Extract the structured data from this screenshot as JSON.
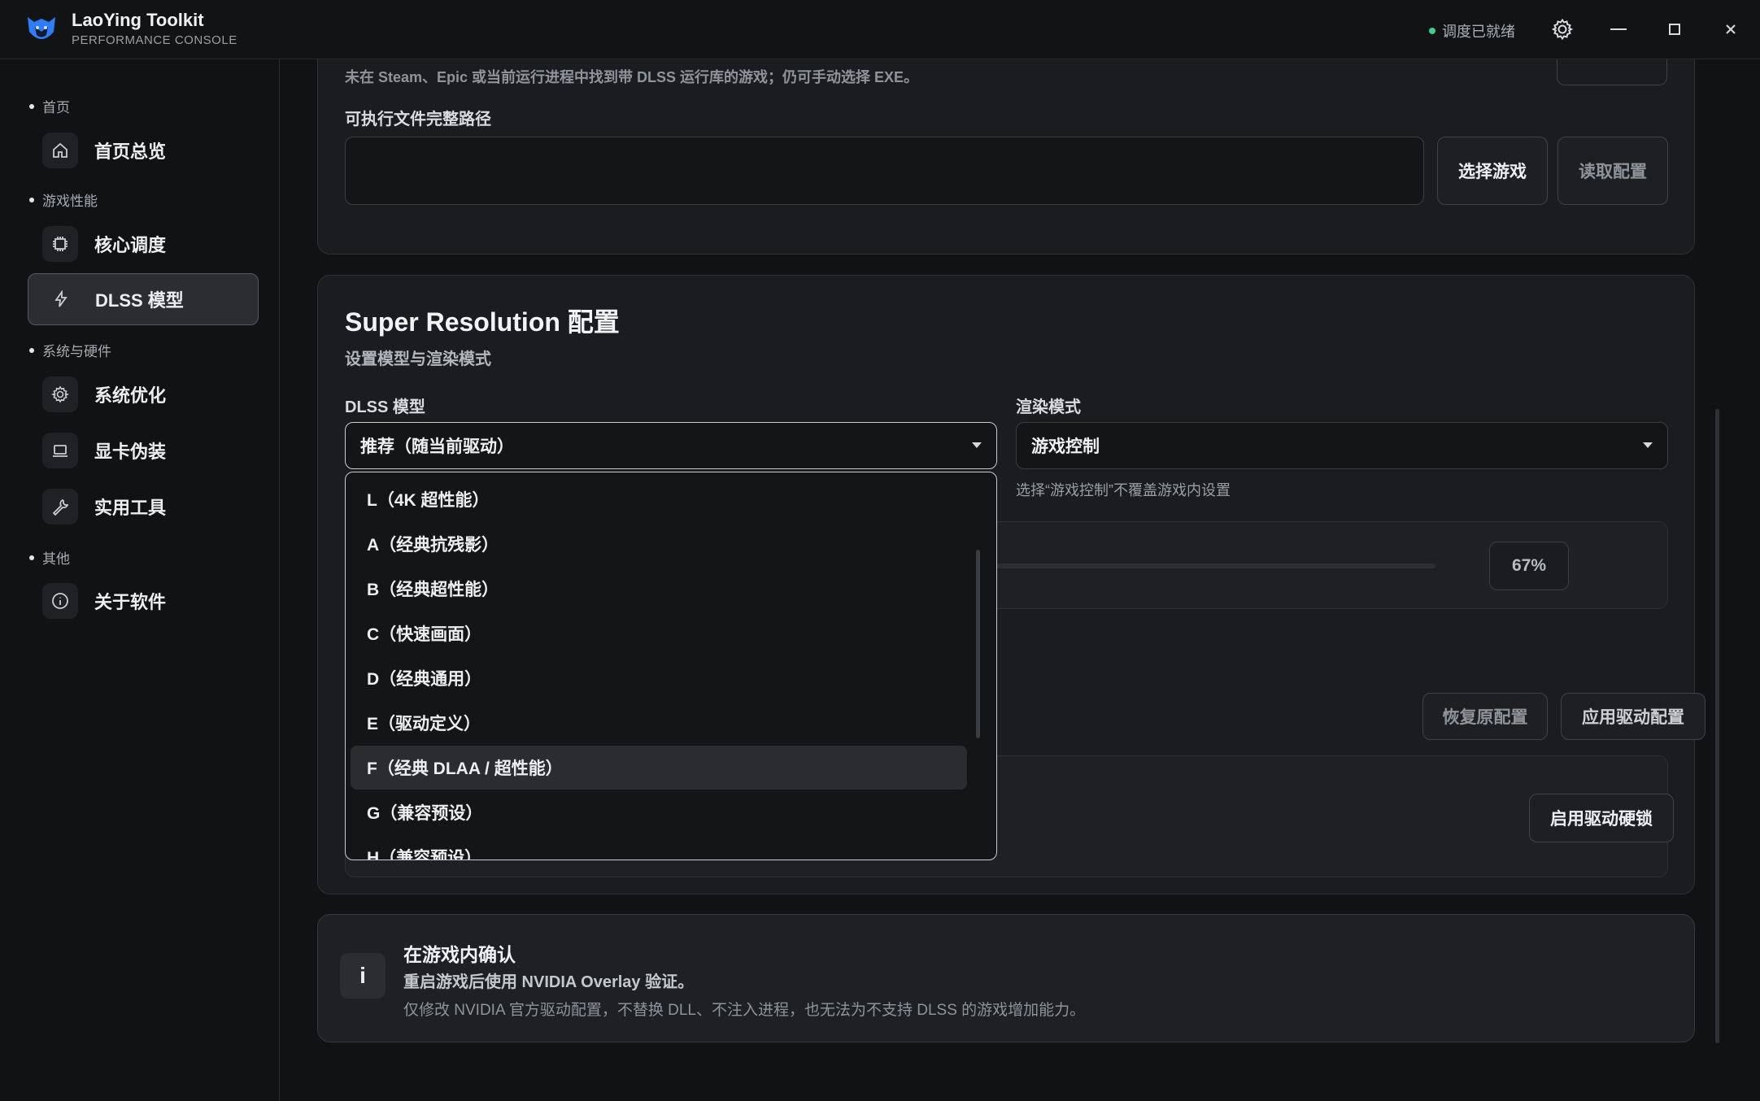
{
  "app": {
    "title": "LaoYing Toolkit",
    "subtitle": "PERFORMANCE CONSOLE",
    "status": "调度已就绪",
    "accent": "#3b8cff",
    "status_color": "#3ecf8e"
  },
  "window_controls": [
    "settings-icon",
    "minimize-icon",
    "maximize-icon",
    "close-icon"
  ],
  "sidebar": {
    "sections": [
      {
        "label": "首页",
        "items": [
          {
            "label": "首页总览",
            "icon": "home-icon"
          }
        ]
      },
      {
        "label": "游戏性能",
        "items": [
          {
            "label": "核心调度",
            "icon": "cpu-icon"
          },
          {
            "label": "DLSS 模型",
            "icon": "bolt-icon",
            "active": true
          }
        ]
      },
      {
        "label": "系统与硬件",
        "items": [
          {
            "label": "系统优化",
            "icon": "gear-icon"
          },
          {
            "label": "显卡伪装",
            "icon": "monitor-icon"
          },
          {
            "label": "实用工具",
            "icon": "wrench-icon"
          }
        ]
      },
      {
        "label": "其他",
        "items": [
          {
            "label": "关于软件",
            "icon": "info-icon"
          }
        ]
      }
    ]
  },
  "game_card": {
    "partial_hint": "未在 Steam、Epic 或当前运行进程中找到带 DLSS 运行库的游戏；仍可手动选择 EXE。",
    "path_label": "可执行文件完整路径",
    "path_value": "",
    "select_button": "选择游戏",
    "read_button": "读取配置"
  },
  "sr_card": {
    "title": "Super Resolution 配置",
    "subtitle": "设置模型与渲染模式",
    "model_label": "DLSS 模型",
    "model_value": "推荐（随当前驱动）",
    "model_options": [
      "L（4K 超性能）",
      "A（经典抗残影）",
      "B（经典超性能）",
      "C（快速画面）",
      "D（经典通用）",
      "E（驱动定义）",
      "F（经典 DLAA / 超性能）",
      "G（兼容预设）",
      "H（兼容预设）"
    ],
    "highlighted_option": "F（经典 DLAA / 超性能）",
    "render_label": "渲染模式",
    "render_value": "游戏控制",
    "render_hint": "选择“游戏控制”不覆盖游戏内设置",
    "slider_value": "67%",
    "slider_fraction": 0.67,
    "restore_button": "恢复原配置",
    "apply_button": "应用驱动配置",
    "hardlock_button": "启用驱动硬锁"
  },
  "info_card": {
    "icon": "i",
    "title": "在游戏内确认",
    "line1": "重启游戏后使用 NVIDIA Overlay 验证。",
    "line2": "仅修改 NVIDIA 官方驱动配置，不替换 DLL、不注入进程，也无法为不支持 DLSS 的游戏增加能力。"
  }
}
